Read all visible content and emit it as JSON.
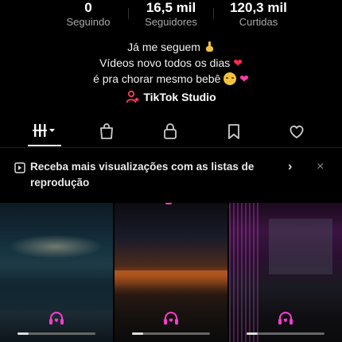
{
  "stats": [
    {
      "value": "0",
      "label": "Seguindo"
    },
    {
      "value": "16,5 mil",
      "label": "Seguidores"
    },
    {
      "value": "120,3 mil",
      "label": "Curtidas"
    }
  ],
  "bio": {
    "line1": "Já me seguem",
    "line2": "Vídeos novo todos os dias",
    "line3": "é pra chorar mesmo bebê"
  },
  "studio": {
    "label": "TikTok Studio"
  },
  "tabs": [
    {
      "icon": "videos-grid-icon",
      "active": true
    },
    {
      "icon": "shopping-bag-icon"
    },
    {
      "icon": "lock-icon"
    },
    {
      "icon": "bookmark-icon"
    },
    {
      "icon": "heart-icon"
    }
  ],
  "banner": {
    "text": "Receba mais visualizações com as listas de reprodução",
    "chevron": "›",
    "close": "×"
  },
  "colors": {
    "background": "#000000",
    "muted": "#a8a8a8",
    "heart": "#ff2b4a",
    "accent_pink": "#ff3bd0"
  }
}
